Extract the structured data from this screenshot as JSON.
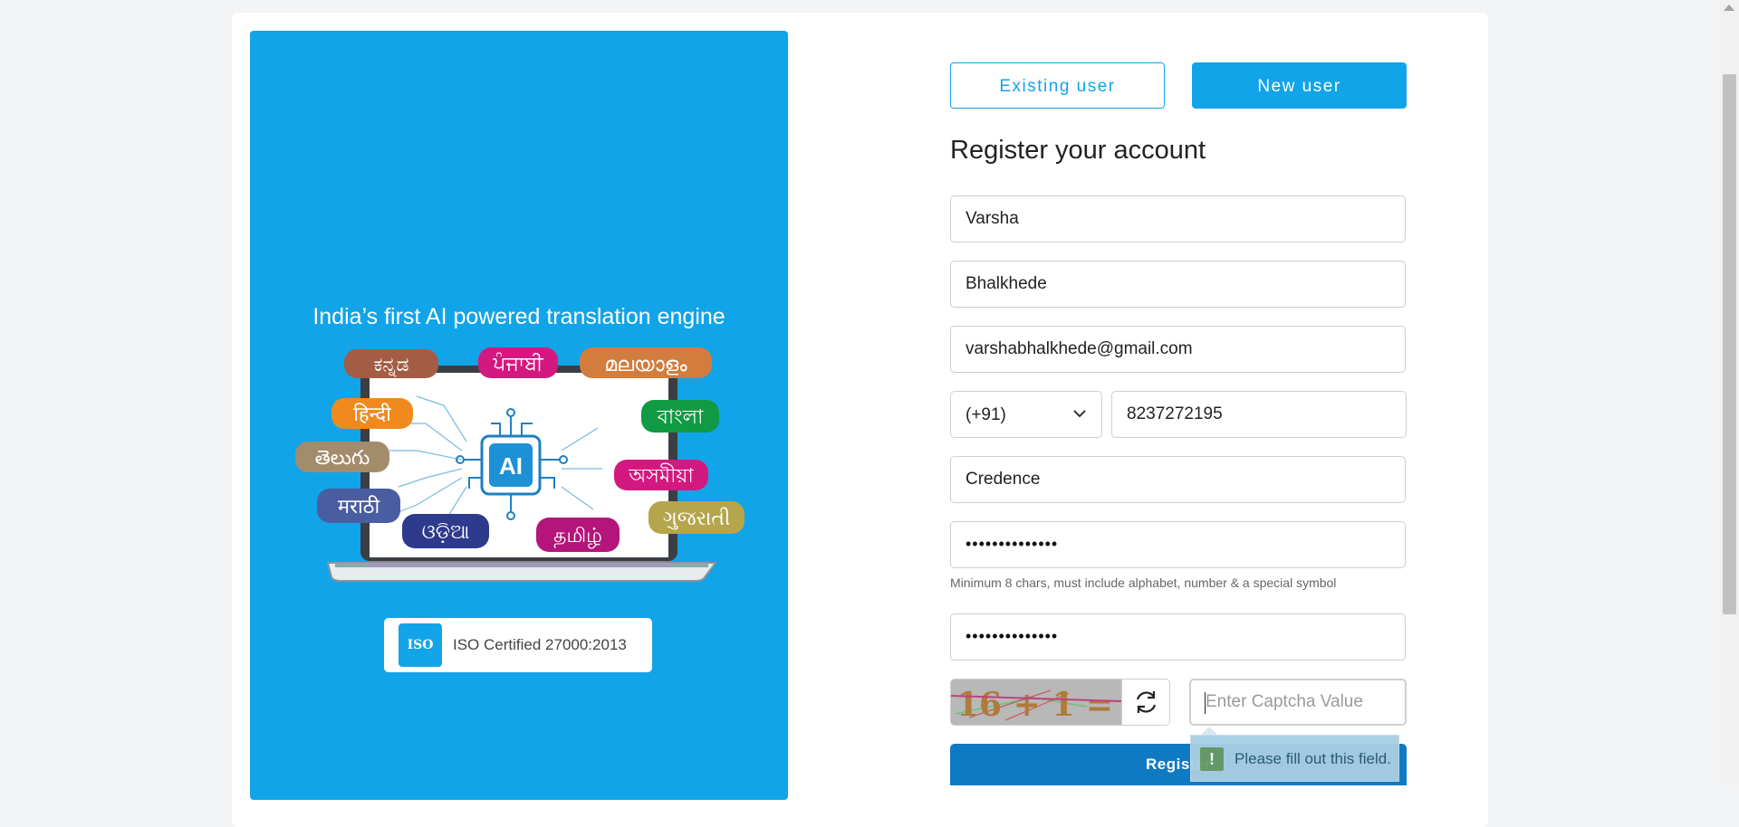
{
  "hero": {
    "title": "India’s first AI powered translation engine",
    "languages": [
      "ಕನ್ನಡ",
      "ਪੰਜਾਬੀ",
      "മലയാളം",
      "हिन्दी",
      "বাংলা",
      "తెలుగు",
      "অসমীয়া",
      "मराठी",
      "ଓଡ଼ିଆ",
      "தமிழ்",
      "ગુજરાતી"
    ],
    "chip_label": "AI",
    "iso_logo": "ISO",
    "iso_text": "ISO Certified 27000:2013"
  },
  "tabs": {
    "existing": "Existing user",
    "new": "New user"
  },
  "form": {
    "title": "Register your account",
    "first_name": "Varsha",
    "last_name": "Bhalkhede",
    "email": "varshabhalkhede@gmail.com",
    "country_code": "(+91)",
    "phone": "8237272195",
    "organization": "Credence",
    "password_mask": "••••••••••••••",
    "password_hint": "Minimum 8 chars, must include alphabet, number & a special symbol",
    "confirm_mask": "••••••••••••••",
    "captcha_placeholder": "Enter Captcha Value",
    "captcha_text": "16 + 1 =",
    "register_label": "Register"
  },
  "tooltip": {
    "icon": "!",
    "text": "Please fill out this field."
  },
  "colors": {
    "brand": "#12a4e8",
    "register": "#0f7ac4"
  }
}
